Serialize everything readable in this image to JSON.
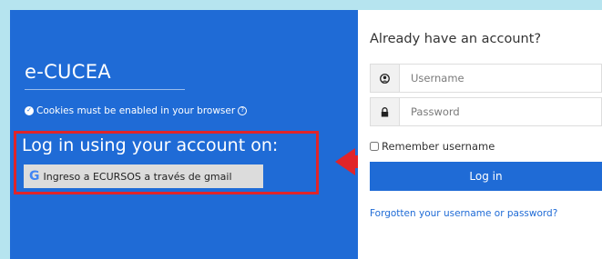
{
  "left": {
    "site_title": "e-CUCEA",
    "cookie_notice": "Cookies must be enabled in your browser",
    "login_using": "Log in using your account on:",
    "google_button_label": "Ingreso a ECURSOS a través de gmail",
    "google_icon_glyph": "G"
  },
  "right": {
    "already_have_account": "Already have an account?",
    "username_placeholder": "Username",
    "password_placeholder": "Password",
    "remember_label": "Remember username",
    "login_button_label": "Log in",
    "forgot_link": "Forgotten your username or password?"
  },
  "icons": {
    "check_circle": "check-circle-icon",
    "help": "help-circle-icon",
    "user": "user-icon",
    "lock": "lock-icon",
    "google": "google-icon",
    "arrow": "red-arrow-icon"
  },
  "colors": {
    "page_bg": "#b6e4ef",
    "primary_blue": "#1f6bd6",
    "highlight_red": "#e0242a",
    "google_button_bg": "#dcdcdc"
  }
}
